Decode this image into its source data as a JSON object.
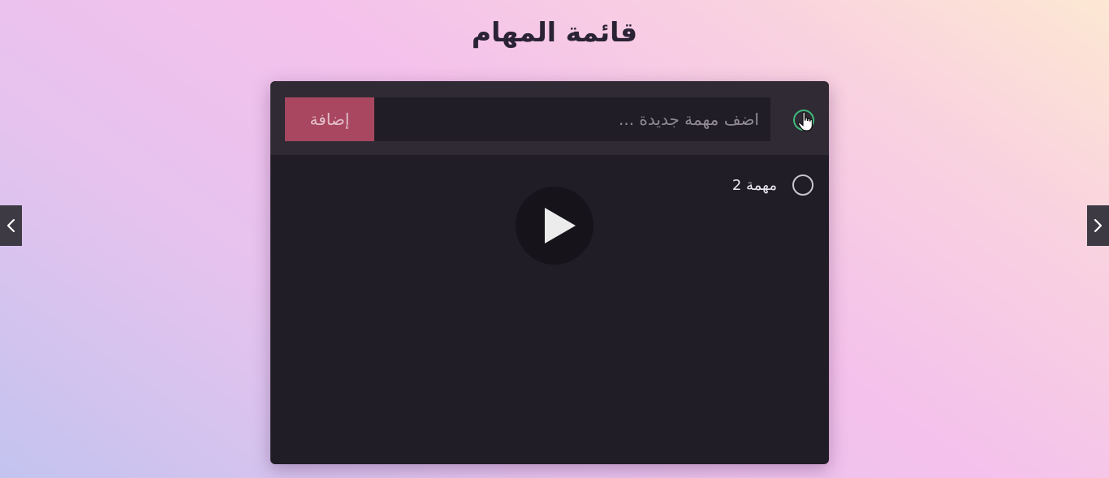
{
  "page": {
    "title": "قائمة المهام"
  },
  "todo": {
    "input_placeholder": "اضف مهمة جديدة ...",
    "input_value": "",
    "add_button_label": "إضافة",
    "tasks": [
      {
        "label": "مهمة 2",
        "completed": false
      }
    ]
  },
  "icons": {
    "toggle_all": "circle-check-icon",
    "cursor": "hand-pointer-icon",
    "play": "play-icon",
    "prev": "chevron-left-icon",
    "next": "chevron-right-icon"
  },
  "colors": {
    "panel_background": "#211d26",
    "header_background": "#2f2a33",
    "accent_button": "#a8475f",
    "toggle_border": "#3fb87c"
  }
}
